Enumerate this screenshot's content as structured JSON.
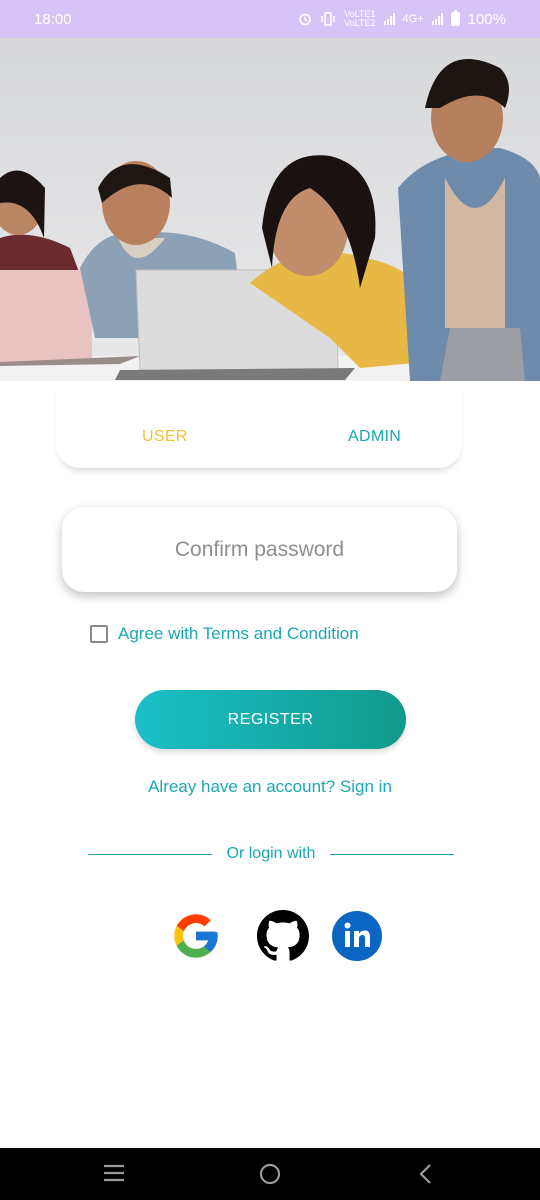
{
  "status_bar": {
    "time": "18:00",
    "network_label": "4G+",
    "volte_label_1": "VoLTE1",
    "volte_label_2": "VoLTE2",
    "battery": "100%"
  },
  "tabs": {
    "user_label": "USER",
    "admin_label": "ADMIN",
    "active": "USER"
  },
  "form": {
    "confirm_password_placeholder": "Confirm password",
    "terms_label": "Agree with Terms and Condition",
    "terms_checked": false,
    "register_label": "REGISTER",
    "signin_link": "Alreay have an account? Sign in",
    "divider_text": "Or login with"
  },
  "social": [
    {
      "name": "google",
      "icon": "google-icon"
    },
    {
      "name": "github",
      "icon": "github-icon"
    },
    {
      "name": "linkedin",
      "icon": "linkedin-icon"
    }
  ],
  "colors": {
    "accent": "#1ba8b2",
    "user_tab": "#f1c232",
    "status_bar": "#d6c4f6"
  },
  "nav": {
    "icons": [
      "menu-icon",
      "home-icon",
      "back-icon"
    ]
  }
}
